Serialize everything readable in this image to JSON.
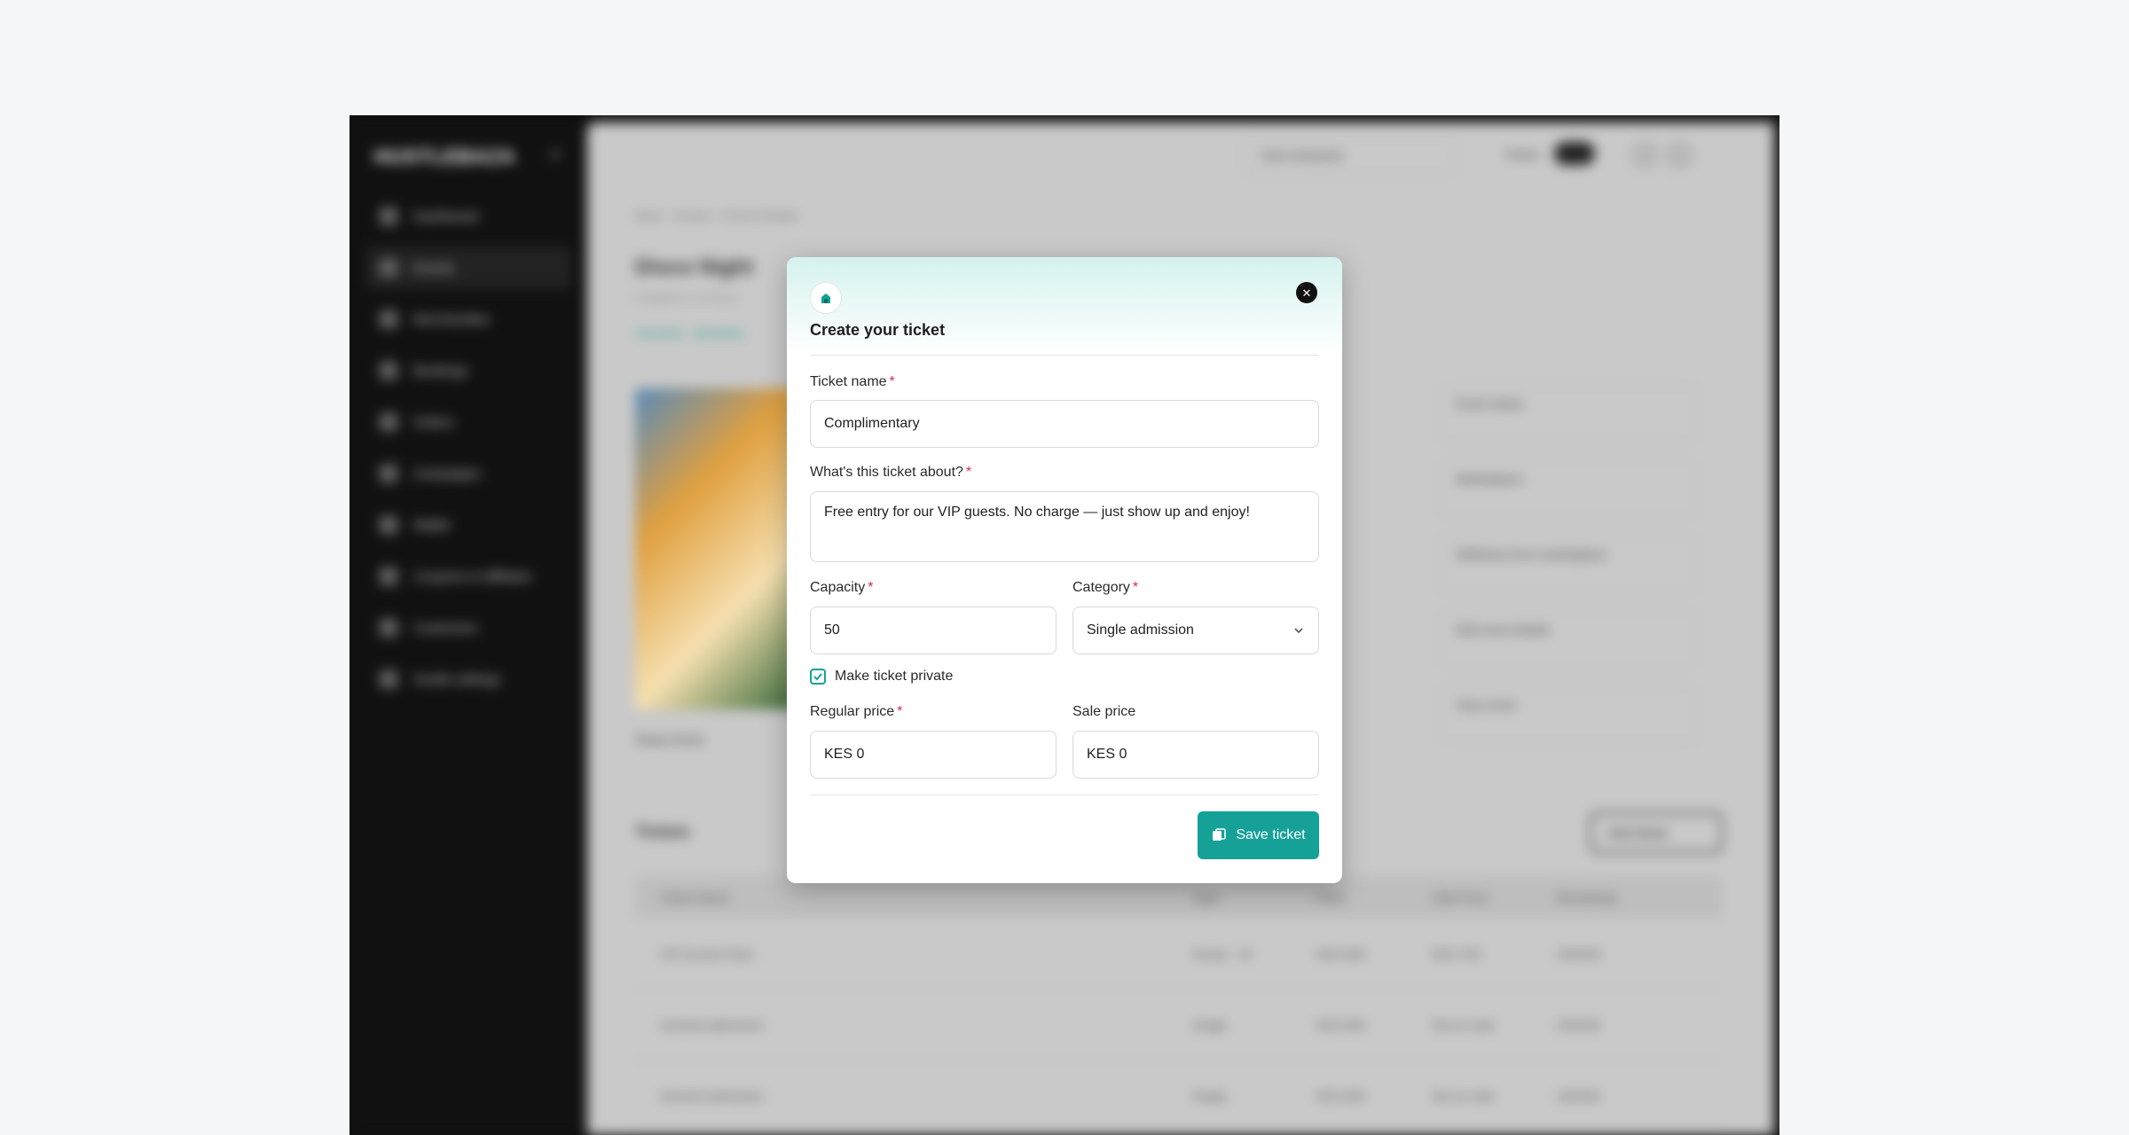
{
  "background_app": {
    "logo": "HUSTLEBAZA",
    "nav": [
      {
        "label": "Dashboard"
      },
      {
        "label": "Events",
        "active": true
      },
      {
        "label": "Merchandise"
      },
      {
        "label": "Bookings"
      },
      {
        "label": "Orders"
      },
      {
        "label": "Campaigns"
      },
      {
        "label": "Wallet"
      },
      {
        "label": "Coupons & affiliates"
      },
      {
        "label": "Customers"
      },
      {
        "label": "Hustle settings"
      }
    ],
    "business": "Sola enterprise",
    "online_label": "Online",
    "breadcrumb": [
      "Back",
      "Events",
      "Event Details"
    ],
    "page_title": "Disco Night",
    "created": "Created on 15 Oct 2",
    "tabs": [
      "Overview",
      "Attendees"
    ],
    "share_label": "Share Event",
    "right_cards": [
      "Event status",
      "Marketplace",
      "Withdraw from marketplace",
      "Edit event details",
      "View event"
    ],
    "tickets_title": "Tickets",
    "add_tickets": "Add tickets",
    "table_headers": [
      "Ticket Name",
      "Type",
      "Price",
      "Sale Price",
      "Remaining"
    ],
    "table_rows": [
      [
        "VIP Access Pass",
        "Group - 10",
        "KES 800",
        "KES 750",
        "100/200"
      ],
      [
        "General admission",
        "Single",
        "KES 800",
        "Not on sale",
        "100/200"
      ],
      [
        "General admission",
        "Single",
        "KES 800",
        "Not on sale",
        "100/200"
      ]
    ]
  },
  "modal": {
    "title": "Create your ticket",
    "accent_color": "#15a197",
    "fields": {
      "ticket_name": {
        "label": "Ticket name",
        "value": "Complimentary"
      },
      "about": {
        "label": "What's this ticket about?",
        "value": "Free entry for our VIP guests. No charge — just show up and enjoy!"
      },
      "capacity": {
        "label": "Capacity",
        "value": "50"
      },
      "category": {
        "label": "Category",
        "value": "Single admission"
      },
      "private": {
        "label": "Make ticket private",
        "checked": true
      },
      "regular_price": {
        "label": "Regular price",
        "value": "KES 0"
      },
      "sale_price": {
        "label": "Sale price",
        "value": "KES 0"
      }
    },
    "required_mark": "*",
    "save_label": "Save ticket"
  }
}
